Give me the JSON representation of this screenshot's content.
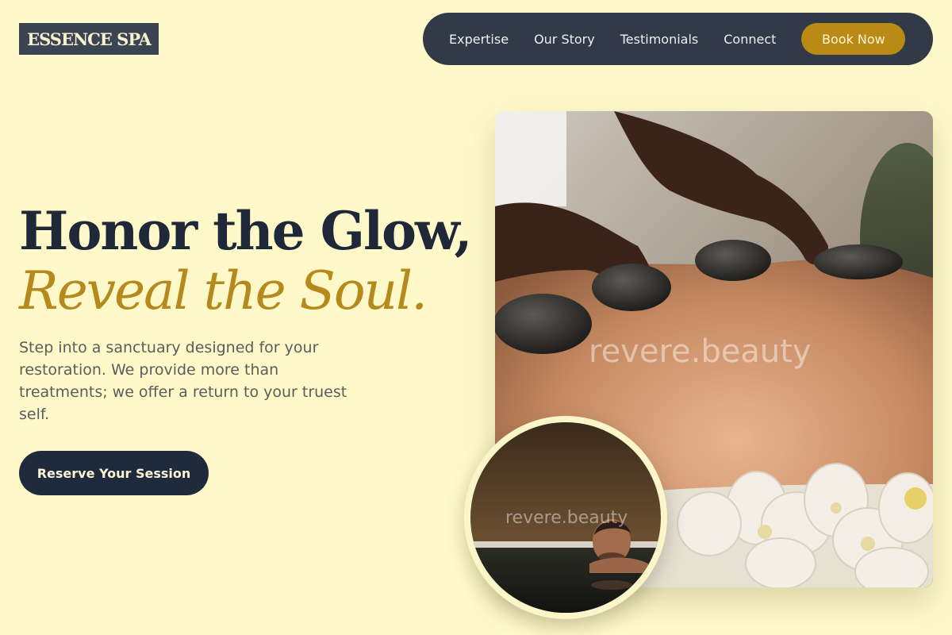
{
  "brand": {
    "logo_text": "ESSENCE SPA"
  },
  "nav": {
    "items": [
      "Expertise",
      "Our Story",
      "Testimonials",
      "Connect"
    ],
    "cta_label": "Book Now"
  },
  "hero": {
    "headline_line1": "Honor the Glow,",
    "headline_line2": "Reveal the Soul.",
    "lede": "Step into a sanctuary designed for your restoration. We provide more than treatments; we offer a return to your truest self.",
    "cta_label": "Reserve Your Session"
  },
  "images": {
    "main_watermark": "revere.beauty",
    "circle_watermark": "revere.beauty",
    "main_description": "hot stone massage",
    "circle_description": "man relaxing in pool"
  },
  "colors": {
    "background": "#fff9c9",
    "nav_bg": "#323a47",
    "accent_gold": "#b98a14",
    "navy": "#1e2839"
  }
}
